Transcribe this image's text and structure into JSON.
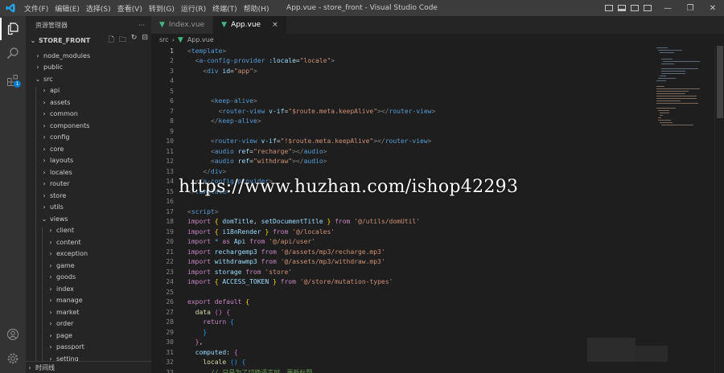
{
  "window": {
    "title": "App.vue - store_front - Visual Studio Code",
    "menu": [
      "文件(F)",
      "编辑(E)",
      "选择(S)",
      "查看(V)",
      "转到(G)",
      "运行(R)",
      "终端(T)",
      "帮助(H)"
    ]
  },
  "activity_bar": {
    "badge_count": "1"
  },
  "sidebar": {
    "header": "资源管理器",
    "more": "···",
    "project": "STORE_FRONT",
    "tree": [
      {
        "label": "node_modules",
        "level": 0,
        "expanded": false
      },
      {
        "label": "public",
        "level": 0,
        "expanded": false
      },
      {
        "label": "src",
        "level": 0,
        "expanded": true
      },
      {
        "label": "api",
        "level": 1,
        "expanded": false
      },
      {
        "label": "assets",
        "level": 1,
        "expanded": false
      },
      {
        "label": "common",
        "level": 1,
        "expanded": false
      },
      {
        "label": "components",
        "level": 1,
        "expanded": false
      },
      {
        "label": "config",
        "level": 1,
        "expanded": false
      },
      {
        "label": "core",
        "level": 1,
        "expanded": false
      },
      {
        "label": "layouts",
        "level": 1,
        "expanded": false
      },
      {
        "label": "locales",
        "level": 1,
        "expanded": false
      },
      {
        "label": "router",
        "level": 1,
        "expanded": false
      },
      {
        "label": "store",
        "level": 1,
        "expanded": false
      },
      {
        "label": "utils",
        "level": 1,
        "expanded": false
      },
      {
        "label": "views",
        "level": 1,
        "expanded": true
      },
      {
        "label": "client",
        "level": 2,
        "expanded": false
      },
      {
        "label": "content",
        "level": 2,
        "expanded": false
      },
      {
        "label": "exception",
        "level": 2,
        "expanded": false
      },
      {
        "label": "game",
        "level": 2,
        "expanded": false
      },
      {
        "label": "goods",
        "level": 2,
        "expanded": false
      },
      {
        "label": "index",
        "level": 2,
        "expanded": false
      },
      {
        "label": "manage",
        "level": 2,
        "expanded": false
      },
      {
        "label": "market",
        "level": 2,
        "expanded": false
      },
      {
        "label": "order",
        "level": 2,
        "expanded": false
      },
      {
        "label": "page",
        "level": 2,
        "expanded": false
      },
      {
        "label": "passport",
        "level": 2,
        "expanded": false
      },
      {
        "label": "setting",
        "level": 2,
        "expanded": false
      }
    ],
    "timeline": "时间线"
  },
  "tabs": [
    {
      "label": "Index.vue",
      "active": false
    },
    {
      "label": "App.vue",
      "active": true
    }
  ],
  "tab_close": "×",
  "breadcrumb": [
    "src",
    "App.vue"
  ],
  "current_line": 1,
  "code": [
    [
      [
        "tg",
        "<"
      ],
      [
        "tn",
        "template"
      ],
      [
        "tg",
        ">"
      ]
    ],
    [
      [
        "pl",
        "  "
      ],
      [
        "tg",
        "<"
      ],
      [
        "tn",
        "a-config-provider"
      ],
      [
        "pl",
        " "
      ],
      [
        "at",
        ":locale"
      ],
      [
        "pl",
        "="
      ],
      [
        "st",
        "\"locale\""
      ],
      [
        "tg",
        ">"
      ]
    ],
    [
      [
        "pl",
        "    "
      ],
      [
        "tg",
        "<"
      ],
      [
        "tn",
        "div"
      ],
      [
        "pl",
        " "
      ],
      [
        "at",
        "id"
      ],
      [
        "pl",
        "="
      ],
      [
        "st",
        "\"app\""
      ],
      [
        "tg",
        ">"
      ]
    ],
    [
      [
        "pl",
        ""
      ]
    ],
    [
      [
        "pl",
        ""
      ]
    ],
    [
      [
        "pl",
        "      "
      ],
      [
        "tg",
        "<"
      ],
      [
        "tn",
        "keep-alive"
      ],
      [
        "tg",
        ">"
      ]
    ],
    [
      [
        "pl",
        "        "
      ],
      [
        "tg",
        "<"
      ],
      [
        "tn",
        "router-view"
      ],
      [
        "pl",
        " "
      ],
      [
        "at",
        "v-if"
      ],
      [
        "pl",
        "="
      ],
      [
        "st",
        "\"$route.meta.keepAlive\""
      ],
      [
        "tg",
        "></"
      ],
      [
        "tn",
        "router-view"
      ],
      [
        "tg",
        ">"
      ]
    ],
    [
      [
        "pl",
        "      "
      ],
      [
        "tg",
        "</"
      ],
      [
        "tn",
        "keep-alive"
      ],
      [
        "tg",
        ">"
      ]
    ],
    [
      [
        "pl",
        ""
      ]
    ],
    [
      [
        "pl",
        "      "
      ],
      [
        "tg",
        "<"
      ],
      [
        "tn",
        "router-view"
      ],
      [
        "pl",
        " "
      ],
      [
        "at",
        "v-if"
      ],
      [
        "pl",
        "="
      ],
      [
        "st",
        "\"!$route.meta.keepAlive\""
      ],
      [
        "tg",
        "></"
      ],
      [
        "tn",
        "router-view"
      ],
      [
        "tg",
        ">"
      ]
    ],
    [
      [
        "pl",
        "      "
      ],
      [
        "tg",
        "<"
      ],
      [
        "tn",
        "audio"
      ],
      [
        "pl",
        " "
      ],
      [
        "at",
        "ref"
      ],
      [
        "pl",
        "="
      ],
      [
        "st",
        "\"recharge\""
      ],
      [
        "tg",
        "></"
      ],
      [
        "tn",
        "audio"
      ],
      [
        "tg",
        ">"
      ]
    ],
    [
      [
        "pl",
        "      "
      ],
      [
        "tg",
        "<"
      ],
      [
        "tn",
        "audio"
      ],
      [
        "pl",
        " "
      ],
      [
        "at",
        "ref"
      ],
      [
        "pl",
        "="
      ],
      [
        "st",
        "\"withdraw\""
      ],
      [
        "tg",
        "></"
      ],
      [
        "tn",
        "audio"
      ],
      [
        "tg",
        ">"
      ]
    ],
    [
      [
        "pl",
        "    "
      ],
      [
        "tg",
        "</"
      ],
      [
        "tn",
        "div"
      ],
      [
        "tg",
        ">"
      ]
    ],
    [
      [
        "pl",
        "  "
      ],
      [
        "tg",
        "</"
      ],
      [
        "tn",
        "a-config-provider"
      ],
      [
        "tg",
        ">"
      ]
    ],
    [
      [
        "tg",
        "</"
      ],
      [
        "tn",
        "template"
      ],
      [
        "tg",
        ">"
      ]
    ],
    [
      [
        "pl",
        ""
      ]
    ],
    [
      [
        "tg",
        "<"
      ],
      [
        "tn",
        "script"
      ],
      [
        "tg",
        ">"
      ]
    ],
    [
      [
        "kw",
        "import"
      ],
      [
        "pl",
        " "
      ],
      [
        "b1",
        "{"
      ],
      [
        "pl",
        " "
      ],
      [
        "id",
        "domTitle"
      ],
      [
        "pl",
        ", "
      ],
      [
        "id",
        "setDocumentTitle"
      ],
      [
        "pl",
        " "
      ],
      [
        "b1",
        "}"
      ],
      [
        "pl",
        " "
      ],
      [
        "kw",
        "from"
      ],
      [
        "pl",
        " "
      ],
      [
        "st",
        "'@/utils/domUtil'"
      ]
    ],
    [
      [
        "kw",
        "import"
      ],
      [
        "pl",
        " "
      ],
      [
        "b1",
        "{"
      ],
      [
        "pl",
        " "
      ],
      [
        "id",
        "i18nRender"
      ],
      [
        "pl",
        " "
      ],
      [
        "b1",
        "}"
      ],
      [
        "pl",
        " "
      ],
      [
        "kw",
        "from"
      ],
      [
        "pl",
        " "
      ],
      [
        "st",
        "'@/locales'"
      ]
    ],
    [
      [
        "kw",
        "import"
      ],
      [
        "pl",
        " "
      ],
      [
        "tn",
        "*"
      ],
      [
        "pl",
        " "
      ],
      [
        "kw",
        "as"
      ],
      [
        "pl",
        " "
      ],
      [
        "id",
        "Api"
      ],
      [
        "pl",
        " "
      ],
      [
        "kw",
        "from"
      ],
      [
        "pl",
        " "
      ],
      [
        "st",
        "'@/api/user'"
      ]
    ],
    [
      [
        "kw",
        "import"
      ],
      [
        "pl",
        " "
      ],
      [
        "id",
        "rechargemp3"
      ],
      [
        "pl",
        " "
      ],
      [
        "kw",
        "from"
      ],
      [
        "pl",
        " "
      ],
      [
        "st",
        "'@/assets/mp3/recharge.mp3'"
      ]
    ],
    [
      [
        "kw",
        "import"
      ],
      [
        "pl",
        " "
      ],
      [
        "id",
        "withdrawmp3"
      ],
      [
        "pl",
        " "
      ],
      [
        "kw",
        "from"
      ],
      [
        "pl",
        " "
      ],
      [
        "st",
        "'@/assets/mp3/withdraw.mp3'"
      ]
    ],
    [
      [
        "kw",
        "import"
      ],
      [
        "pl",
        " "
      ],
      [
        "id",
        "storage"
      ],
      [
        "pl",
        " "
      ],
      [
        "kw",
        "from"
      ],
      [
        "pl",
        " "
      ],
      [
        "st",
        "'store'"
      ]
    ],
    [
      [
        "kw",
        "import"
      ],
      [
        "pl",
        " "
      ],
      [
        "b1",
        "{"
      ],
      [
        "pl",
        " "
      ],
      [
        "id",
        "ACCESS_TOKEN"
      ],
      [
        "pl",
        " "
      ],
      [
        "b1",
        "}"
      ],
      [
        "pl",
        " "
      ],
      [
        "kw",
        "from"
      ],
      [
        "pl",
        " "
      ],
      [
        "st",
        "'@/store/mutation-types'"
      ]
    ],
    [
      [
        "pl",
        ""
      ]
    ],
    [
      [
        "kw",
        "export"
      ],
      [
        "pl",
        " "
      ],
      [
        "kw",
        "default"
      ],
      [
        "pl",
        " "
      ],
      [
        "b1",
        "{"
      ]
    ],
    [
      [
        "pl",
        "  "
      ],
      [
        "fn",
        "data"
      ],
      [
        "pl",
        " "
      ],
      [
        "b2",
        "("
      ],
      [
        "b2",
        ")"
      ],
      [
        "pl",
        " "
      ],
      [
        "b2",
        "{"
      ]
    ],
    [
      [
        "pl",
        "    "
      ],
      [
        "kw",
        "return"
      ],
      [
        "pl",
        " "
      ],
      [
        "b3",
        "{"
      ]
    ],
    [
      [
        "pl",
        "    "
      ],
      [
        "b3",
        "}"
      ]
    ],
    [
      [
        "pl",
        "  "
      ],
      [
        "b2",
        "}"
      ],
      [
        "pl",
        ","
      ]
    ],
    [
      [
        "pl",
        "  "
      ],
      [
        "id",
        "computed"
      ],
      [
        "pl",
        ": "
      ],
      [
        "b2",
        "{"
      ]
    ],
    [
      [
        "pl",
        "    "
      ],
      [
        "fn",
        "locale"
      ],
      [
        "pl",
        " "
      ],
      [
        "b3",
        "("
      ],
      [
        "b3",
        ")"
      ],
      [
        "pl",
        " "
      ],
      [
        "b3",
        "{"
      ]
    ],
    [
      [
        "pl",
        "      "
      ],
      [
        "cm",
        "// 只是为了切换语言时，更新标题"
      ]
    ]
  ],
  "watermark": "https://www.huzhan.com/ishop42293"
}
